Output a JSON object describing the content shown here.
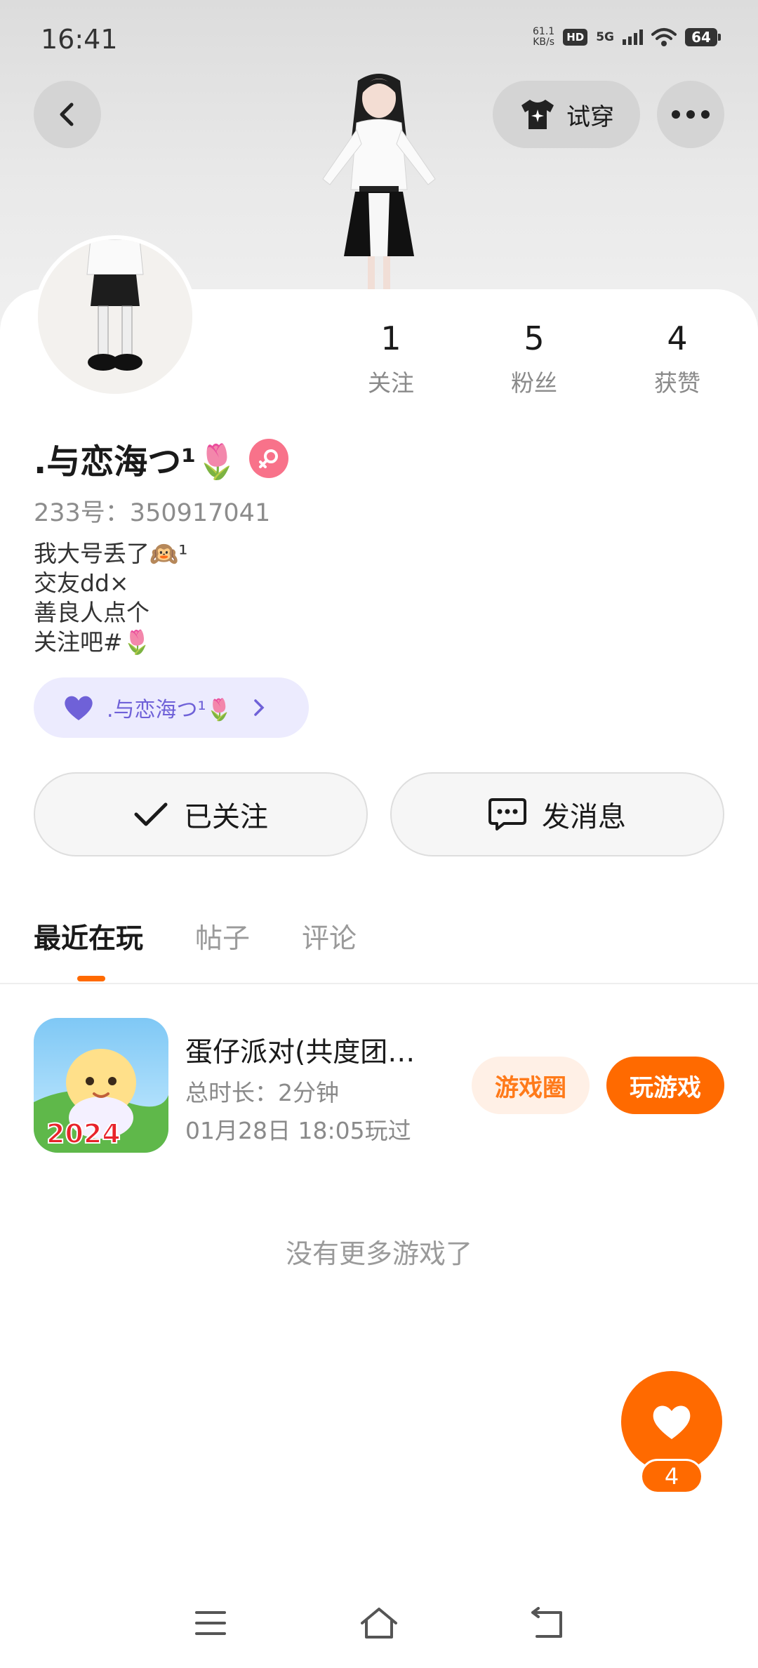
{
  "status_bar": {
    "time": "16:41",
    "speed_value": "61.1",
    "speed_unit": "KB/s",
    "hd": "HD",
    "network": "5G",
    "battery": "64"
  },
  "header": {
    "tryon_label": "试穿"
  },
  "profile": {
    "stats": [
      {
        "value": "1",
        "label": "关注"
      },
      {
        "value": "5",
        "label": "粉丝"
      },
      {
        "value": "4",
        "label": "获赞"
      }
    ],
    "username": ".与恋海つ¹🌷",
    "id_text": "233号：350917041",
    "bio_lines": [
      "我大号丢了🙉¹",
      "交友dd×",
      "善良人点个",
      "关注吧#🌷"
    ],
    "linked_account": ".与恋海つ¹🌷",
    "follow_label": "已关注",
    "message_label": "发消息"
  },
  "tabs": [
    {
      "label": "最近在玩",
      "active": true
    },
    {
      "label": "帖子",
      "active": false
    },
    {
      "label": "评论",
      "active": false
    }
  ],
  "games": [
    {
      "name": "蛋仔派对(共度团…",
      "duration": "总时长：2分钟",
      "last_played": "01月28日 18:05玩过",
      "icon_badge": "2024",
      "circle_label": "游戏圈",
      "play_label": "玩游戏"
    }
  ],
  "empty_text": "没有更多游戏了",
  "fab": {
    "count": "4"
  },
  "colors": {
    "accent": "#ff6a00",
    "accent_light": "#fff0e6",
    "chip_bg": "#ecebfe",
    "chip_text": "#6f61d8",
    "gender_pink": "#f8728a"
  },
  "icons": {
    "back": "back-arrow-icon",
    "tryon": "tshirt-sparkle-icon",
    "more": "more-dots-icon",
    "gender": "female-icon",
    "link": "heart-icon",
    "follow": "check-icon",
    "message": "chat-bubble-icon",
    "fab": "heart-icon"
  }
}
